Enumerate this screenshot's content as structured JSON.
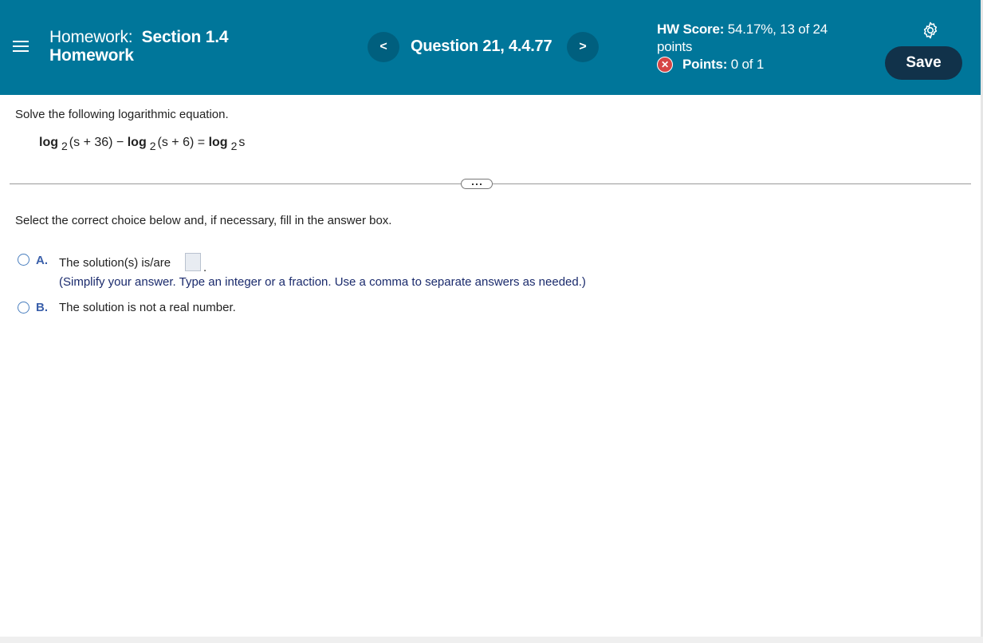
{
  "header": {
    "title_lead": "Homework:",
    "title_bold_1": "Section 1.4",
    "title_bold_2": "Homework",
    "prev_label": "<",
    "next_label": ">",
    "question_label": "Question 21, 4.4.77",
    "score_label": "HW Score:",
    "score_value": "54.17%, 13 of 24",
    "score_unit": "points",
    "points_label": "Points:",
    "points_value": "0 of 1",
    "save_label": "Save",
    "icons": {
      "menu": "menu-icon",
      "settings": "gear-icon",
      "incorrect": "x-circle-icon"
    },
    "colors": {
      "header_bg": "#00769a",
      "save_bg": "#11324a",
      "incorrect": "#d64545"
    }
  },
  "question": {
    "instruction": "Solve the following logarithmic equation.",
    "equation": {
      "t1_fn": "log",
      "t1_base": "2",
      "t1_arg": "(s + 36)",
      "op1": "−",
      "t2_fn": "log",
      "t2_base": "2",
      "t2_arg": "(s + 6)",
      "eq": "=",
      "t3_fn": "log",
      "t3_base": "2",
      "t3_arg": "s"
    }
  },
  "answer": {
    "instruction": "Select the correct choice below and, if necessary, fill in the answer box.",
    "option_a": {
      "letter": "A.",
      "text": "The solution(s) is/are",
      "after_box": ".",
      "hint": "(Simplify your answer. Type an integer or a fraction. Use a comma to separate answers as needed.)",
      "input_value": ""
    },
    "option_b": {
      "letter": "B.",
      "text": "The solution is not a real number."
    }
  }
}
